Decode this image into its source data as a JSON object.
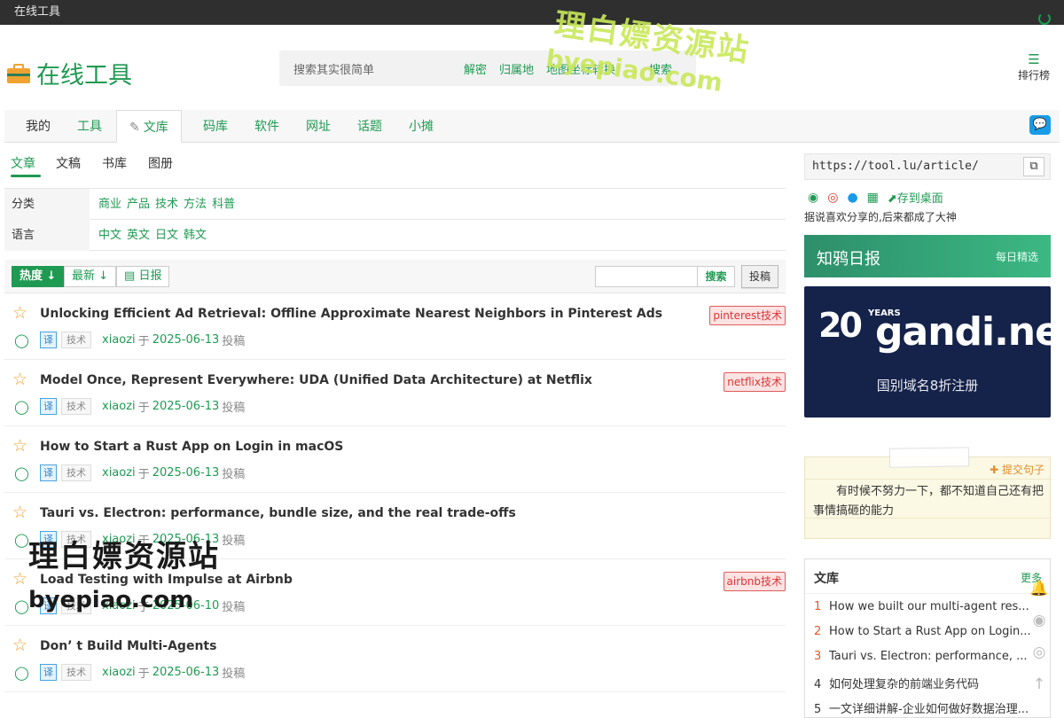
{
  "topbar": {
    "title": "在线工具"
  },
  "header": {
    "logo_text": "在线工具",
    "search": {
      "placeholder": "搜索其实很简单",
      "links": [
        "解密",
        "归属地",
        "地图坐标转换"
      ],
      "button": "搜索"
    },
    "rank_label": "排行榜",
    "rank_icon": "list-icon"
  },
  "nav": {
    "items": [
      "我的",
      "工具",
      "文库",
      "码库",
      "软件",
      "网址",
      "话题",
      "小摊"
    ],
    "active": "文库",
    "chat_icon": "chat-bubble-icon"
  },
  "subtabs": {
    "items": [
      "文章",
      "文稿",
      "书库",
      "图册"
    ],
    "active": "文章"
  },
  "filters": [
    {
      "label": "分类",
      "options": [
        "商业",
        "产品",
        "技术",
        "方法",
        "科普"
      ]
    },
    {
      "label": "语言",
      "options": [
        "中文",
        "英文",
        "日文",
        "韩文"
      ]
    }
  ],
  "toolbar": {
    "hot": "热度",
    "latest": "最新",
    "daily": "日报",
    "search_button": "搜索",
    "post_button": "投稿"
  },
  "articles": [
    {
      "title": "Unlocking Efficient Ad Retrieval: Offline Approximate Nearest Neighbors in Pinterest Ads",
      "tag": "pinterest技术",
      "badge": "译",
      "category": "技术",
      "author": "xiaozi",
      "yu": "于",
      "date": "2025-06-13",
      "action": "投稿"
    },
    {
      "title": "Model Once, Represent Everywhere: UDA (Unified Data Architecture) at Netflix",
      "tag": "netflix技术",
      "badge": "译",
      "category": "技术",
      "author": "xiaozi",
      "yu": "于",
      "date": "2025-06-13",
      "action": "投稿"
    },
    {
      "title": "How to Start a Rust App on Login in macOS",
      "tag": "",
      "badge": "译",
      "category": "技术",
      "author": "xiaozi",
      "yu": "于",
      "date": "2025-06-13",
      "action": "投稿"
    },
    {
      "title": "Tauri vs. Electron: performance, bundle size, and the real trade-offs",
      "tag": "",
      "badge": "译",
      "category": "技术",
      "author": "xiaozi",
      "yu": "于",
      "date": "2025-06-13",
      "action": "投稿"
    },
    {
      "title": "Load Testing with Impulse at Airbnb",
      "tag": "airbnb技术",
      "badge": "译",
      "category": "技术",
      "author": "xiaozi",
      "yu": "于",
      "date": "2025-06-10",
      "action": "投稿"
    },
    {
      "title": "Don’ t Build Multi-Agents",
      "tag": "",
      "badge": "译",
      "category": "技术",
      "author": "xiaozi",
      "yu": "于",
      "date": "2025-06-13",
      "action": "投稿"
    }
  ],
  "sidebar": {
    "url": "https://tool.lu/article/",
    "share": {
      "save_label": "存到桌面",
      "tip": "据说喜欢分享的,后来都成了大神"
    },
    "zhihu": {
      "title": "知鸦日报",
      "sub": "每日精选"
    },
    "ad": {
      "num": "20",
      "years": "YEARS",
      "brand": "gandi.net",
      "text": "国别域名8折注册"
    },
    "note": {
      "submit": "提交句子",
      "quote": "有时候不努力一下，都不知道自己还有把事情搞砸的能力"
    },
    "library": {
      "title": "文库",
      "more": "更多",
      "items": [
        {
          "n": "1",
          "text": "How we built our multi-agent res..."
        },
        {
          "n": "2",
          "text": "How to Start a Rust App on Login..."
        },
        {
          "n": "3",
          "text": "Tauri vs. Electron: performance, ..."
        },
        {
          "n": "4",
          "text": "如何处理复杂的前端业务代码"
        },
        {
          "n": "5",
          "text": "一文详细讲解-企业如何做好数据治理..."
        }
      ]
    }
  },
  "watermarks": {
    "cn": "理白嫖资源站",
    "en": "byepiao.com"
  },
  "colors": {
    "accent": "#1f9a52",
    "tag_red": "#d33",
    "star": "#f0a330"
  }
}
